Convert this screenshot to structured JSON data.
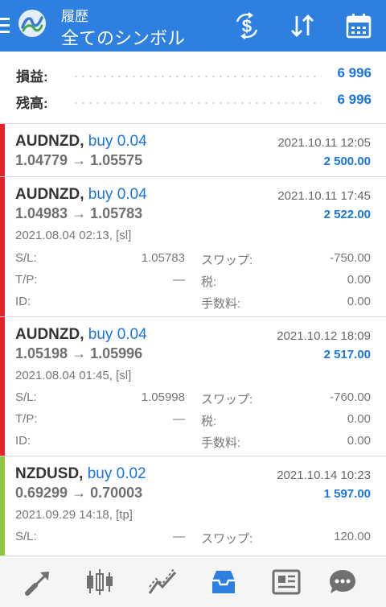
{
  "header": {
    "subtitle": "履歴",
    "title": "全てのシンボル",
    "icons": [
      "menu-icon",
      "app-logo",
      "currency-swap-icon",
      "sort-icon",
      "calendar-icon"
    ]
  },
  "summary": {
    "profit_label": "損益:",
    "profit_value": "6 996",
    "balance_label": "残高:",
    "balance_value": "6 996"
  },
  "labels": {
    "sl": "S/L:",
    "tp": "T/P:",
    "id": "ID:",
    "swap": "スワップ:",
    "tax": "税:",
    "fee": "手数料:"
  },
  "trades": [
    {
      "symbol": "AUDNZD,",
      "side": "buy 0.04",
      "time": "2021.10.11 12:05",
      "prices": "1.04779 → 1.05575",
      "profit": "2 500.00",
      "color": "#e8202a"
    },
    {
      "symbol": "AUDNZD,",
      "side": "buy 0.04",
      "time": "2021.10.11 17:45",
      "prices": "1.04983 → 1.05783",
      "profit": "2 522.00",
      "open_time": "2021.08.04 02:13, [sl]",
      "sl": "1.05783",
      "tp": "—",
      "swap": "-750.00",
      "tax": "0.00",
      "fee": "0.00",
      "color": "#e8202a"
    },
    {
      "symbol": "AUDNZD,",
      "side": "buy 0.04",
      "time": "2021.10.12 18:09",
      "prices": "1.05198 → 1.05996",
      "profit": "2 517.00",
      "open_time": "2021.08.04 01:45, [sl]",
      "sl": "1.05998",
      "tp": "—",
      "swap": "-760.00",
      "tax": "0.00",
      "fee": "0.00",
      "color": "#e8202a"
    },
    {
      "symbol": "NZDUSD,",
      "side": "buy 0.02",
      "time": "2021.10.14 10:23",
      "prices": "0.69299 → 0.70003",
      "profit": "1 597.00",
      "open_time": "2021.09.29 14:18, [tp]",
      "sl": "—",
      "swap": "120.00",
      "color": "#8cc63f"
    }
  ],
  "bottom_nav": {
    "items": [
      "trade-icon",
      "chart-icon",
      "indicators-icon",
      "history-icon",
      "news-icon",
      "chat-icon"
    ],
    "active_color": "#2d7fe0"
  }
}
